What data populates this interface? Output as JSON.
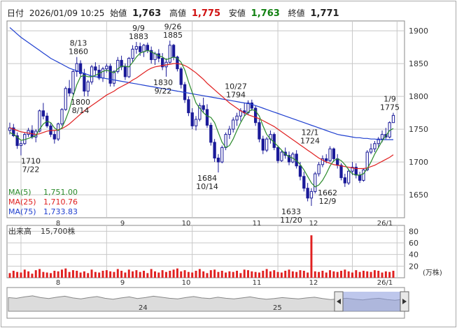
{
  "header": {
    "date_label": "日付",
    "date_value": "2026/01/09 10:25",
    "open_label": "始値",
    "open_value": "1,763",
    "high_label": "高値",
    "high_value": "1,775",
    "low_label": "安値",
    "low_value": "1,763",
    "close_label": "終値",
    "close_value": "1,771"
  },
  "colors": {
    "up": "#1a1a99",
    "down": "#1a1a99",
    "ma5": "#2a8a2a",
    "ma25": "#e02020",
    "ma75": "#2040d0",
    "high_text": "#d01010",
    "low_text": "#108010",
    "volume": "#e02020",
    "grid": "#c8c8c8"
  },
  "legend": {
    "ma5_label": "MA(5)",
    "ma5_value": "1,751.00",
    "ma25_label": "MA(25)",
    "ma25_value": "1,710.76",
    "ma75_label": "MA(75)",
    "ma75_value": "1,733.83"
  },
  "volume_panel": {
    "label": "出来高",
    "value": "15,700株",
    "unit": "(万株)"
  },
  "navigator": {
    "year_labels": [
      "24",
      "25"
    ]
  },
  "chart_data": {
    "type": "candlestick",
    "title": "",
    "price_axis_ticks": [
      1650,
      1700,
      1750,
      1800,
      1850,
      1900
    ],
    "ylim": [
      1615,
      1915
    ],
    "volume_axis_ticks": [
      20,
      40,
      60,
      80
    ],
    "volume_ylim": [
      0,
      90
    ],
    "month_labels": [
      "8",
      "9",
      "10",
      "11",
      "12",
      "26/1"
    ],
    "annotations": [
      {
        "date": "8/13",
        "value": 1860
      },
      {
        "date": "9/9",
        "value": 1883
      },
      {
        "date": "9/26",
        "value": 1885
      },
      {
        "date": "8/14",
        "value": 1800
      },
      {
        "date": "9/22",
        "value": 1830
      },
      {
        "date": "7/22",
        "value": 1710
      },
      {
        "date": "10/27",
        "value": 1794
      },
      {
        "date": "10/14",
        "value": 1684
      },
      {
        "date": "12/1",
        "value": 1724
      },
      {
        "date": "11/20",
        "value": 1633
      },
      {
        "date": "12/9",
        "value": 1662
      },
      {
        "date": "1/9",
        "value": 1775
      }
    ],
    "candles": [
      [
        1748,
        1760,
        1742,
        1752
      ],
      [
        1752,
        1758,
        1738,
        1740
      ],
      [
        1740,
        1745,
        1720,
        1725
      ],
      [
        1725,
        1732,
        1710,
        1728
      ],
      [
        1728,
        1745,
        1726,
        1742
      ],
      [
        1742,
        1752,
        1738,
        1748
      ],
      [
        1748,
        1756,
        1735,
        1738
      ],
      [
        1738,
        1750,
        1730,
        1747
      ],
      [
        1747,
        1780,
        1745,
        1778
      ],
      [
        1778,
        1790,
        1765,
        1770
      ],
      [
        1770,
        1775,
        1752,
        1755
      ],
      [
        1755,
        1760,
        1738,
        1742
      ],
      [
        1742,
        1748,
        1728,
        1735
      ],
      [
        1735,
        1760,
        1732,
        1758
      ],
      [
        1758,
        1782,
        1755,
        1780
      ],
      [
        1780,
        1815,
        1778,
        1812
      ],
      [
        1812,
        1825,
        1800,
        1805
      ],
      [
        1805,
        1840,
        1802,
        1838
      ],
      [
        1838,
        1860,
        1830,
        1850
      ],
      [
        1850,
        1855,
        1830,
        1835
      ],
      [
        1835,
        1842,
        1800,
        1808
      ],
      [
        1808,
        1825,
        1800,
        1822
      ],
      [
        1822,
        1848,
        1818,
        1845
      ],
      [
        1845,
        1852,
        1832,
        1840
      ],
      [
        1840,
        1848,
        1825,
        1828
      ],
      [
        1828,
        1845,
        1822,
        1842
      ],
      [
        1842,
        1850,
        1836,
        1846
      ],
      [
        1846,
        1850,
        1815,
        1820
      ],
      [
        1820,
        1840,
        1815,
        1838
      ],
      [
        1838,
        1860,
        1835,
        1855
      ],
      [
        1855,
        1862,
        1840,
        1845
      ],
      [
        1845,
        1850,
        1825,
        1830
      ],
      [
        1830,
        1860,
        1828,
        1858
      ],
      [
        1858,
        1878,
        1852,
        1872
      ],
      [
        1872,
        1883,
        1865,
        1876
      ],
      [
        1876,
        1882,
        1862,
        1868
      ],
      [
        1868,
        1880,
        1860,
        1878
      ],
      [
        1878,
        1882,
        1866,
        1870
      ],
      [
        1870,
        1876,
        1850,
        1856
      ],
      [
        1856,
        1868,
        1848,
        1865
      ],
      [
        1865,
        1872,
        1852,
        1858
      ],
      [
        1858,
        1866,
        1840,
        1845
      ],
      [
        1845,
        1858,
        1830,
        1852
      ],
      [
        1852,
        1885,
        1850,
        1878
      ],
      [
        1878,
        1880,
        1855,
        1860
      ],
      [
        1860,
        1862,
        1838,
        1842
      ],
      [
        1842,
        1845,
        1812,
        1818
      ],
      [
        1818,
        1822,
        1790,
        1795
      ],
      [
        1795,
        1800,
        1770,
        1775
      ],
      [
        1775,
        1782,
        1750,
        1755
      ],
      [
        1755,
        1770,
        1748,
        1765
      ],
      [
        1765,
        1790,
        1762,
        1786
      ],
      [
        1786,
        1798,
        1775,
        1780
      ],
      [
        1780,
        1788,
        1752,
        1756
      ],
      [
        1756,
        1760,
        1725,
        1730
      ],
      [
        1730,
        1735,
        1700,
        1706
      ],
      [
        1706,
        1712,
        1684,
        1700
      ],
      [
        1700,
        1725,
        1698,
        1722
      ],
      [
        1722,
        1745,
        1718,
        1742
      ],
      [
        1742,
        1755,
        1735,
        1750
      ],
      [
        1750,
        1768,
        1745,
        1764
      ],
      [
        1764,
        1775,
        1755,
        1770
      ],
      [
        1770,
        1782,
        1762,
        1778
      ],
      [
        1778,
        1790,
        1770,
        1775
      ],
      [
        1775,
        1794,
        1772,
        1790
      ],
      [
        1790,
        1795,
        1778,
        1782
      ],
      [
        1782,
        1786,
        1755,
        1760
      ],
      [
        1760,
        1765,
        1730,
        1735
      ],
      [
        1735,
        1740,
        1712,
        1718
      ],
      [
        1718,
        1738,
        1715,
        1735
      ],
      [
        1735,
        1748,
        1728,
        1742
      ],
      [
        1742,
        1745,
        1718,
        1722
      ],
      [
        1722,
        1725,
        1698,
        1702
      ],
      [
        1702,
        1718,
        1700,
        1715
      ],
      [
        1715,
        1722,
        1705,
        1710
      ],
      [
        1710,
        1716,
        1695,
        1700
      ],
      [
        1700,
        1715,
        1698,
        1712
      ],
      [
        1712,
        1718,
        1690,
        1694
      ],
      [
        1694,
        1700,
        1672,
        1678
      ],
      [
        1678,
        1685,
        1655,
        1660
      ],
      [
        1660,
        1668,
        1640,
        1645
      ],
      [
        1645,
        1660,
        1633,
        1655
      ],
      [
        1655,
        1685,
        1652,
        1682
      ],
      [
        1682,
        1700,
        1678,
        1696
      ],
      [
        1696,
        1710,
        1692,
        1705
      ],
      [
        1705,
        1712,
        1698,
        1702
      ],
      [
        1702,
        1724,
        1700,
        1720
      ],
      [
        1720,
        1722,
        1700,
        1705
      ],
      [
        1705,
        1712,
        1690,
        1695
      ],
      [
        1695,
        1698,
        1672,
        1676
      ],
      [
        1676,
        1682,
        1662,
        1668
      ],
      [
        1668,
        1690,
        1665,
        1686
      ],
      [
        1686,
        1700,
        1680,
        1692
      ],
      [
        1692,
        1698,
        1675,
        1680
      ],
      [
        1680,
        1685,
        1668,
        1672
      ],
      [
        1672,
        1690,
        1670,
        1688
      ],
      [
        1688,
        1718,
        1686,
        1715
      ],
      [
        1715,
        1728,
        1712,
        1720
      ],
      [
        1720,
        1732,
        1715,
        1728
      ],
      [
        1728,
        1738,
        1722,
        1735
      ],
      [
        1735,
        1748,
        1730,
        1742
      ],
      [
        1742,
        1752,
        1735,
        1738
      ],
      [
        1738,
        1762,
        1736,
        1760
      ],
      [
        1760,
        1775,
        1763,
        1771
      ]
    ],
    "volumes": [
      8,
      12,
      10,
      9,
      14,
      11,
      7,
      13,
      15,
      10,
      9,
      8,
      12,
      11,
      14,
      16,
      10,
      13,
      12,
      9,
      11,
      8,
      14,
      10,
      9,
      12,
      13,
      11,
      10,
      15,
      12,
      9,
      14,
      11,
      13,
      10,
      12,
      8,
      15,
      11,
      9,
      13,
      10,
      12,
      14,
      16,
      11,
      13,
      10,
      9,
      12,
      15,
      11,
      8,
      13,
      14,
      10,
      12,
      9,
      11,
      10,
      12,
      8,
      14,
      13,
      11,
      10,
      9,
      12,
      15,
      11,
      13,
      10,
      9,
      12,
      14,
      11,
      10,
      13,
      12,
      9,
      73,
      11,
      10,
      12,
      9,
      13,
      11,
      10,
      12,
      14,
      11,
      9,
      13,
      10,
      12,
      11,
      10,
      13,
      12,
      9,
      11,
      10,
      12
    ],
    "ma5": [
      1745,
      1742,
      1738,
      1733,
      1734,
      1736,
      1738,
      1740,
      1750,
      1758,
      1762,
      1760,
      1752,
      1748,
      1752,
      1765,
      1780,
      1800,
      1818,
      1830,
      1832,
      1830,
      1830,
      1832,
      1835,
      1838,
      1840,
      1838,
      1836,
      1842,
      1846,
      1846,
      1845,
      1852,
      1860,
      1866,
      1868,
      1870,
      1868,
      1865,
      1862,
      1860,
      1856,
      1858,
      1860,
      1858,
      1852,
      1840,
      1822,
      1806,
      1790,
      1782,
      1775,
      1770,
      1768,
      1760,
      1745,
      1730,
      1722,
      1725,
      1735,
      1748,
      1760,
      1770,
      1776,
      1780,
      1778,
      1770,
      1755,
      1742,
      1735,
      1730,
      1724,
      1718,
      1712,
      1708,
      1706,
      1702,
      1696,
      1688,
      1678,
      1668,
      1662,
      1665,
      1672,
      1682,
      1694,
      1702,
      1705,
      1702,
      1696,
      1688,
      1682,
      1680,
      1680,
      1682,
      1690,
      1700,
      1712,
      1722,
      1732,
      1740,
      1748,
      1751
    ],
    "ma25": [
      1752,
      1750,
      1748,
      1746,
      1745,
      1744,
      1743,
      1742,
      1743,
      1745,
      1747,
      1748,
      1748,
      1749,
      1751,
      1754,
      1758,
      1763,
      1768,
      1773,
      1778,
      1782,
      1786,
      1790,
      1794,
      1798,
      1802,
      1805,
      1808,
      1812,
      1815,
      1818,
      1821,
      1825,
      1828,
      1832,
      1836,
      1840,
      1843,
      1845,
      1846,
      1847,
      1848,
      1849,
      1850,
      1850,
      1849,
      1847,
      1844,
      1840,
      1836,
      1831,
      1826,
      1820,
      1815,
      1810,
      1805,
      1800,
      1795,
      1790,
      1786,
      1782,
      1778,
      1775,
      1772,
      1770,
      1768,
      1766,
      1763,
      1760,
      1757,
      1754,
      1750,
      1746,
      1742,
      1738,
      1734,
      1730,
      1726,
      1722,
      1718,
      1714,
      1710,
      1706,
      1703,
      1700,
      1698,
      1696,
      1695,
      1694,
      1693,
      1692,
      1691,
      1690,
      1690,
      1690,
      1691,
      1693,
      1695,
      1698,
      1701,
      1704,
      1707,
      1711
    ],
    "ma75": [
      1905,
      1900,
      1895,
      1890,
      1886,
      1882,
      1878,
      1874,
      1870,
      1866,
      1862,
      1858,
      1855,
      1852,
      1849,
      1846,
      1843,
      1841,
      1839,
      1837,
      1835,
      1833,
      1831,
      1830,
      1829,
      1828,
      1827,
      1826,
      1825,
      1824,
      1823,
      1822,
      1821,
      1820,
      1819,
      1818,
      1817,
      1816,
      1815,
      1814,
      1813,
      1812,
      1811,
      1810,
      1809,
      1808,
      1807,
      1806,
      1805,
      1804,
      1803,
      1802,
      1801,
      1800,
      1799,
      1798,
      1797,
      1796,
      1795,
      1794,
      1793,
      1792,
      1791,
      1790,
      1789,
      1788,
      1786,
      1784,
      1782,
      1780,
      1778,
      1776,
      1774,
      1772,
      1770,
      1768,
      1766,
      1764,
      1762,
      1760,
      1758,
      1756,
      1754,
      1752,
      1750,
      1748,
      1746,
      1744,
      1742,
      1741,
      1740,
      1739,
      1738,
      1737,
      1737,
      1736,
      1736,
      1735,
      1735,
      1734,
      1734,
      1734,
      1734,
      1734
    ],
    "navigator_series": [
      40,
      38,
      42,
      45,
      40,
      37,
      41,
      44,
      39,
      36,
      40,
      43,
      38,
      35,
      39,
      42,
      37,
      40,
      44,
      41,
      38,
      36,
      40,
      43,
      39,
      37,
      41,
      38,
      36,
      39,
      42,
      38,
      35,
      37,
      40,
      38,
      36,
      39,
      41,
      37,
      34,
      36,
      38,
      35,
      33,
      36,
      38,
      34,
      32,
      35
    ]
  }
}
